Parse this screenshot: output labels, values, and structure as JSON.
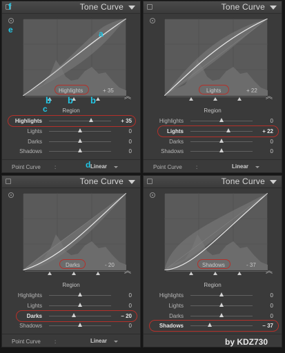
{
  "panels": [
    {
      "title": "Tone Curve",
      "curve_label": "Highlights",
      "curve_value": "+ 35",
      "region_label": "Region",
      "sliders": [
        {
          "name": "Highlights",
          "value": "+ 35",
          "level": 0.675
        },
        {
          "name": "Lights",
          "value": "0",
          "level": 0.5
        },
        {
          "name": "Darks",
          "value": "0",
          "level": 0.5
        },
        {
          "name": "Shadows",
          "value": "0",
          "level": 0.5
        }
      ],
      "point_curve_label": "Point Curve",
      "point_curve_value": "Linear"
    },
    {
      "title": "Tone Curve",
      "curve_label": "Lights",
      "curve_value": "+ 22",
      "region_label": "Region",
      "sliders": [
        {
          "name": "Highlights",
          "value": "0",
          "level": 0.5
        },
        {
          "name": "Lights",
          "value": "+ 22",
          "level": 0.61
        },
        {
          "name": "Darks",
          "value": "0",
          "level": 0.5
        },
        {
          "name": "Shadows",
          "value": "0",
          "level": 0.5
        }
      ],
      "point_curve_label": "Point Curve",
      "point_curve_value": "Linear"
    },
    {
      "title": "Tone Curve",
      "curve_label": "Darks",
      "curve_value": "- 20",
      "region_label": "Region",
      "sliders": [
        {
          "name": "Highlights",
          "value": "0",
          "level": 0.5
        },
        {
          "name": "Lights",
          "value": "0",
          "level": 0.5
        },
        {
          "name": "Darks",
          "value": "– 20",
          "level": 0.4
        },
        {
          "name": "Shadows",
          "value": "0",
          "level": 0.5
        }
      ],
      "point_curve_label": "Point Curve",
      "point_curve_value": "Linear"
    },
    {
      "title": "Tone Curve",
      "curve_label": "Shadows",
      "curve_value": "- 37",
      "region_label": "Region",
      "sliders": [
        {
          "name": "Highlights",
          "value": "0",
          "level": 0.5
        },
        {
          "name": "Lights",
          "value": "0",
          "level": 0.5
        },
        {
          "name": "Darks",
          "value": "0",
          "level": 0.5
        },
        {
          "name": "Shadows",
          "value": "– 37",
          "level": 0.315
        }
      ],
      "point_curve_label": "Point Curve",
      "point_curve_value": "Linear"
    }
  ],
  "annotations": {
    "a": "a",
    "b": "b",
    "c": "c",
    "d": "d",
    "e": "e",
    "f": "f"
  },
  "watermark": "by KDZ730",
  "colors": {
    "panel_bg": "#3a3a3a",
    "highlight_oval": "#b5302a",
    "annotation": "#22c7e6"
  },
  "icons": [
    "panel-switch-icon",
    "target-adjust-icon",
    "collapse-panel-icon",
    "double-chevron-up-icon",
    "dropdown-arrow-icon"
  ]
}
